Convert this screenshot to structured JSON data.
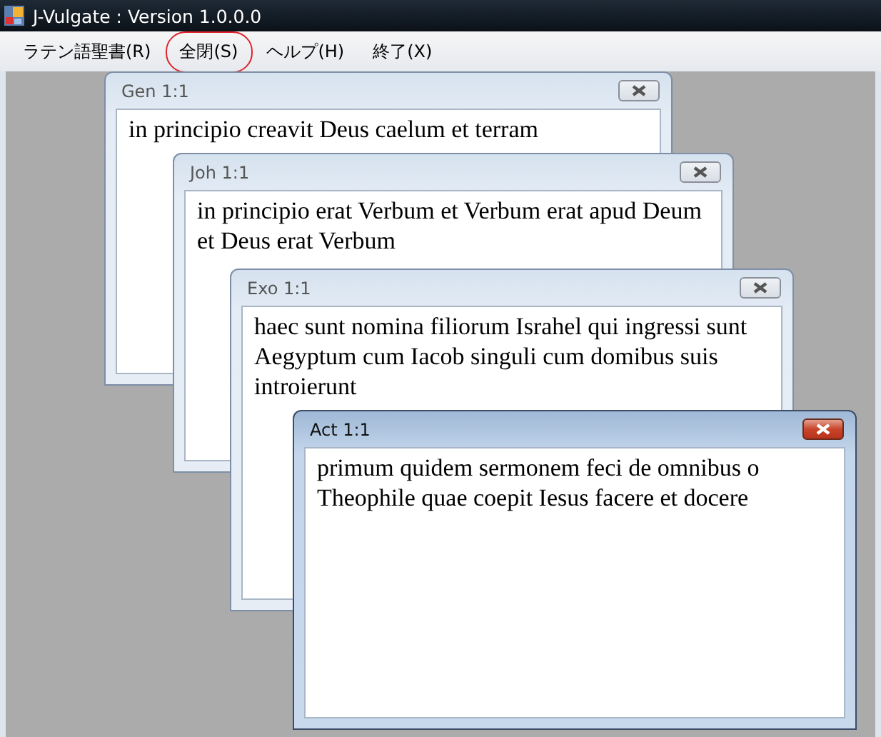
{
  "window": {
    "title": "J-Vulgate : Version 1.0.0.0"
  },
  "menu": [
    {
      "label": "ラテン語聖書(R)",
      "circled": false
    },
    {
      "label": "全閉(S)",
      "circled": true
    },
    {
      "label": "ヘルプ(H)",
      "circled": false
    },
    {
      "label": "終了(X)",
      "circled": false
    }
  ],
  "child_windows": [
    {
      "title": "Gen 1:1",
      "text": "in principio creavit Deus caelum et terram",
      "active": false
    },
    {
      "title": "Joh 1:1",
      "text": "in principio erat Verbum et Verbum erat apud Deum et Deus erat Verbum",
      "active": false
    },
    {
      "title": "Exo 1:1",
      "text": "haec sunt nomina filiorum Israhel qui ingressi sunt Aegyptum cum Iacob singuli cum domibus suis introierunt",
      "active": false
    },
    {
      "title": "Act 1:1",
      "text": "primum quidem sermonem feci de omnibus o Theophile quae coepit Iesus facere et docere",
      "active": true
    }
  ]
}
